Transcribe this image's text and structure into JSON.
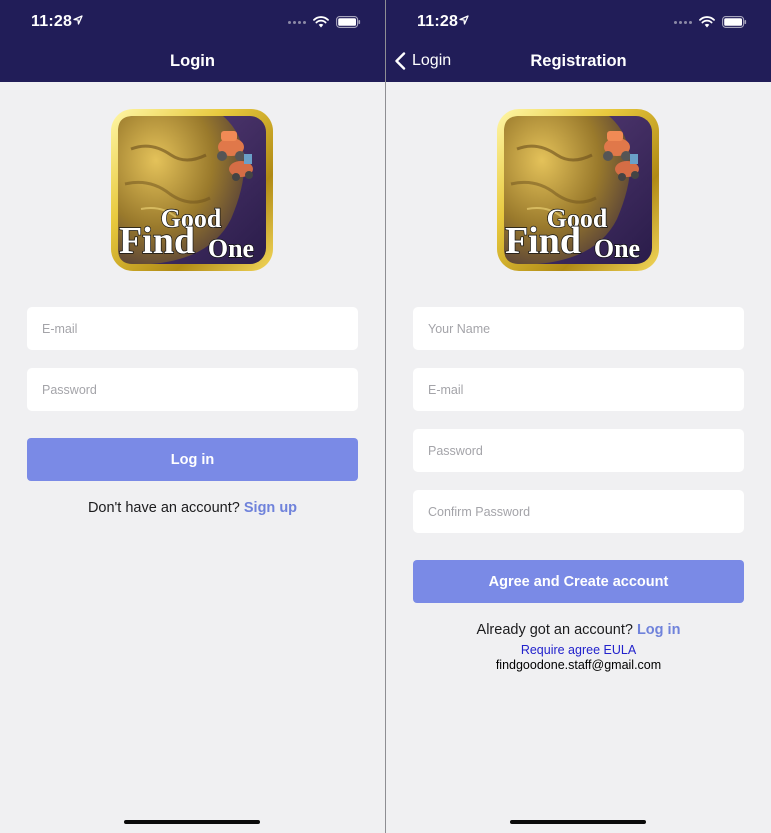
{
  "status_bar": {
    "time": "11:28"
  },
  "login_screen": {
    "nav_title": "Login",
    "logo": {
      "word_find": "Find",
      "word_good": "Good",
      "word_one": "One"
    },
    "email_placeholder": "E-mail",
    "password_placeholder": "Password",
    "login_button": "Log in",
    "signup_prompt": "Don't have an account?",
    "signup_link": "Sign up"
  },
  "registration_screen": {
    "back_label": "Login",
    "nav_title": "Registration",
    "logo": {
      "word_find": "Find",
      "word_good": "Good",
      "word_one": "One"
    },
    "name_placeholder": "Your Name",
    "email_placeholder": "E-mail",
    "password_placeholder": "Password",
    "confirm_placeholder": "Confirm Password",
    "create_button": "Agree and Create account",
    "login_prompt": "Already got an account?",
    "login_link": "Log in",
    "eula_link": "Require agree EULA",
    "contact_email": "findgoodone.staff@gmail.com"
  },
  "colors": {
    "nav_bar": "#211d58",
    "primary_button": "#7a8ae6",
    "link": "#6f82db",
    "eula_link": "#2222cc",
    "background": "#f0f0f2"
  },
  "icons": [
    "location-arrow-icon",
    "cellular-signal-icon",
    "wifi-icon",
    "battery-icon",
    "back-chevron-icon",
    "app-logo"
  ]
}
